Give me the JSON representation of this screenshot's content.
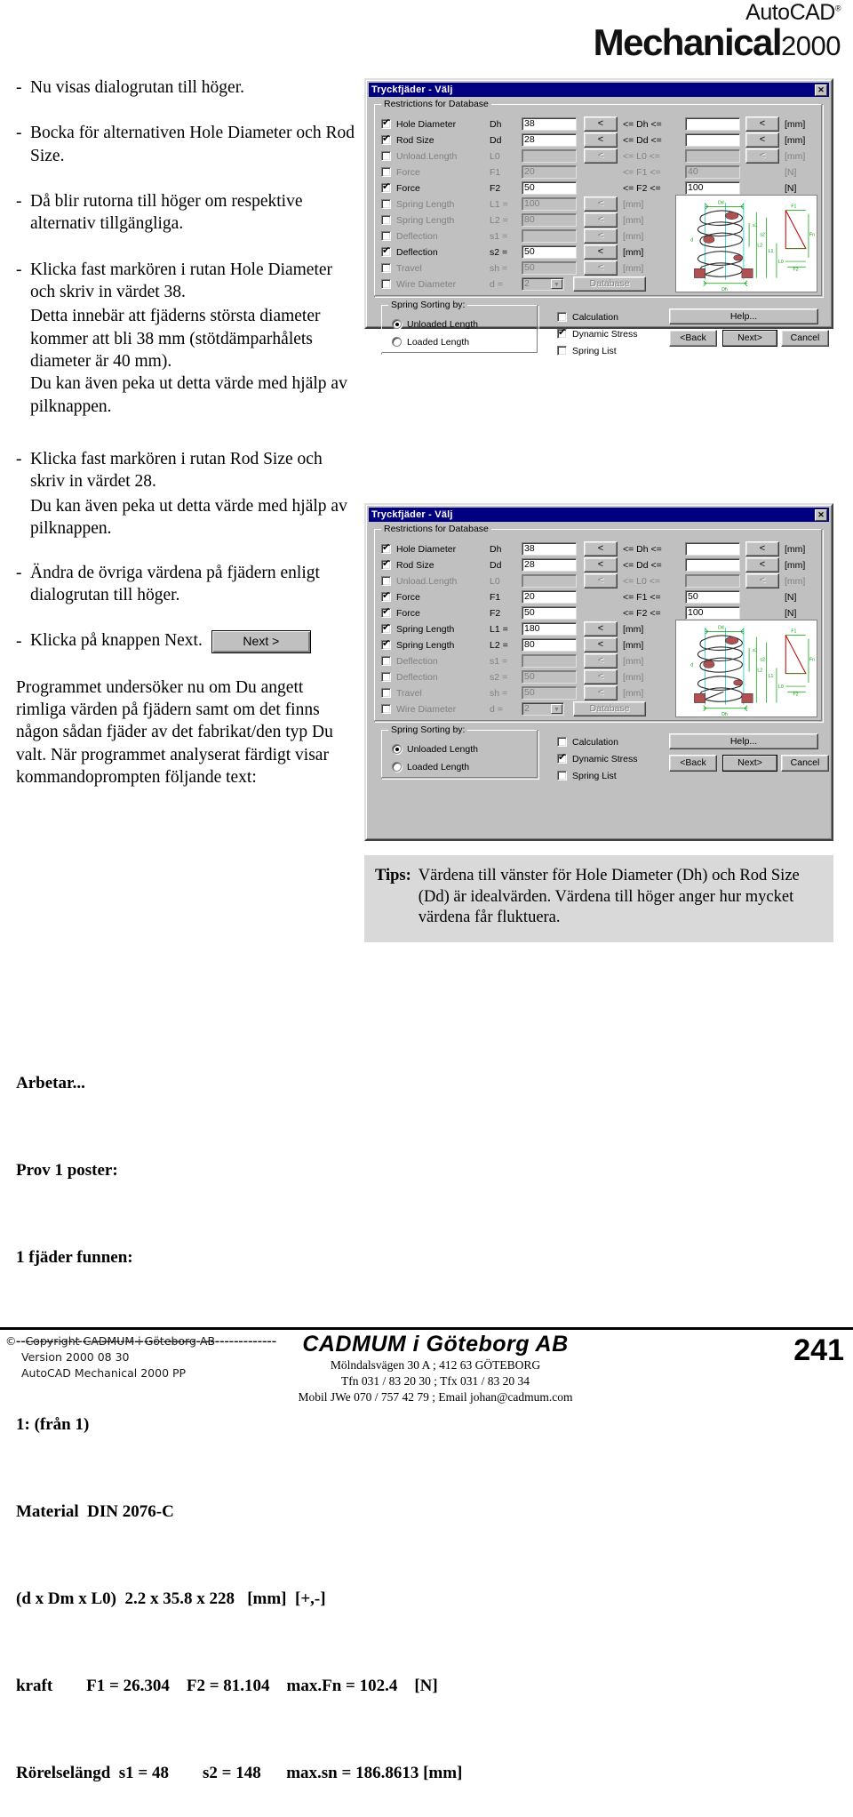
{
  "logo": {
    "auto": "AutoCAD",
    "reg": "®",
    "mechanical": "Mechanical",
    "year": "2000"
  },
  "left": {
    "b1": "Nu visas dialogrutan till höger.",
    "b2": "Bocka för alternativen Hole Diameter och Rod Size.",
    "b3": "Då blir rutorna till höger om respektive alternativ tillgängliga.",
    "b4": "Klicka fast markören i rutan Hole Diameter och skriv in värdet 38.",
    "b4p1": "Detta innebär att fjäderns största diameter kommer att bli 38 mm (stötdämparhålets diameter är 40 mm).",
    "b4p2": "Du kan även peka ut detta värde med hjälp av pilknappen.",
    "b5": "Klicka fast markören i rutan Rod Size och skriv in värdet 28.",
    "b5p1": "Du kan även peka ut detta värde med hjälp av pilknappen.",
    "b6": "Ändra de övriga värdena på fjädern enligt dialogrutan till höger.",
    "b7": "Klicka på knappen Next.",
    "next_button": "Next >",
    "para_final": "Programmet undersöker nu om Du angett rimliga värden på fjädern samt om det finns någon sådan fjäder av det fabrikat/den typ Du valt. När programmet analyserat färdigt visar kommandoprompten följande text:"
  },
  "tips": {
    "label": "Tips:",
    "text": "Värdena till vänster för Hole Diameter (Dh) och Rod Size (Dd) är idealvärden. Värdena till höger anger hur mycket värdena får fluktuera."
  },
  "dialog": {
    "title": "Tryckfjäder - Välj",
    "close": "✕",
    "group_restrictions": "Restrictions for Database",
    "group_sorting": "Spring Sorting by:",
    "arrow_glyph": "<",
    "unit_mm": "[mm]",
    "unit_n": "[N]",
    "database_button": "Database",
    "help_button": "Help...",
    "back_button": "<Back",
    "next_button": "Next>",
    "cancel_button": "Cancel",
    "radio_unloaded": "Unloaded Length",
    "radio_loaded": "Loaded Length",
    "chk_calculation": "Calculation",
    "chk_dynamic": "Dynamic Stress",
    "chk_springlist": "Spring List"
  },
  "dialog1": {
    "rows": [
      {
        "label": "Hole Diameter",
        "checked": true,
        "sym": "Dh",
        "val1": "38",
        "op": "<= Dh <=",
        "val2": "",
        "unit": "[mm]",
        "enabled": true,
        "has_arrow1": true,
        "has_arrow2": true
      },
      {
        "label": "Rod Size",
        "checked": true,
        "sym": "Dd",
        "val1": "28",
        "op": "<= Dd <=",
        "val2": "",
        "unit": "[mm]",
        "enabled": true,
        "has_arrow1": true,
        "has_arrow2": true
      },
      {
        "label": "Unload.Length",
        "checked": false,
        "sym": "L0",
        "val1": "",
        "op": "<= L0 <=",
        "val2": "",
        "unit": "[mm]",
        "enabled": false,
        "has_arrow1": true,
        "has_arrow2": true
      },
      {
        "label": "Force",
        "checked": false,
        "sym": "F1",
        "val1": "20",
        "op": "<= F1 <=",
        "val2": "40",
        "unit": "[N]",
        "enabled": false,
        "has_arrow1": false,
        "has_arrow2": false
      },
      {
        "label": "Force",
        "checked": true,
        "sym": "F2",
        "val1": "50",
        "op": "<= F2 <=",
        "val2": "100",
        "unit": "[N]",
        "enabled": true,
        "has_arrow1": false,
        "has_arrow2": false
      },
      {
        "label": "Spring Length",
        "checked": false,
        "sym": "L1 =",
        "val1": "100",
        "op": "",
        "val2": "",
        "unit": "[mm]",
        "enabled": false,
        "has_arrow1": true,
        "has_arrow2": false
      },
      {
        "label": "Spring Length",
        "checked": false,
        "sym": "L2 =",
        "val1": "80",
        "op": "",
        "val2": "",
        "unit": "[mm]",
        "enabled": false,
        "has_arrow1": true,
        "has_arrow2": false
      },
      {
        "label": "Deflection",
        "checked": false,
        "sym": "s1 =",
        "val1": "",
        "op": "",
        "val2": "",
        "unit": "[mm]",
        "enabled": false,
        "has_arrow1": true,
        "has_arrow2": false
      },
      {
        "label": "Deflection",
        "checked": true,
        "sym": "s2 =",
        "val1": "50",
        "op": "",
        "val2": "",
        "unit": "[mm]",
        "enabled": true,
        "has_arrow1": true,
        "has_arrow2": false
      },
      {
        "label": "Travel",
        "checked": false,
        "sym": "sh =",
        "val1": "50",
        "op": "",
        "val2": "",
        "unit": "[mm]",
        "enabled": false,
        "has_arrow1": true,
        "has_arrow2": false
      },
      {
        "label": "Wire Diameter",
        "checked": false,
        "sym": "d =",
        "val1": "2",
        "op": "",
        "val2": "",
        "unit": "",
        "enabled": false,
        "has_arrow1": false,
        "has_arrow2": false
      }
    ],
    "sorting_selected": "Unloaded Length",
    "checks": {
      "calculation": false,
      "dynamic_stress": true,
      "spring_list": false
    }
  },
  "dialog2": {
    "rows": [
      {
        "label": "Hole Diameter",
        "checked": true,
        "sym": "Dh",
        "val1": "38",
        "op": "<= Dh <=",
        "val2": "",
        "unit": "[mm]",
        "enabled": true,
        "has_arrow1": true,
        "has_arrow2": true
      },
      {
        "label": "Rod Size",
        "checked": true,
        "sym": "Dd",
        "val1": "28",
        "op": "<= Dd <=",
        "val2": "",
        "unit": "[mm]",
        "enabled": true,
        "has_arrow1": true,
        "has_arrow2": true
      },
      {
        "label": "Unload.Length",
        "checked": false,
        "sym": "L0",
        "val1": "",
        "op": "<= L0 <=",
        "val2": "",
        "unit": "[mm]",
        "enabled": false,
        "has_arrow1": true,
        "has_arrow2": true
      },
      {
        "label": "Force",
        "checked": true,
        "sym": "F1",
        "val1": "20",
        "op": "<= F1 <=",
        "val2": "50",
        "unit": "[N]",
        "enabled": true,
        "has_arrow1": false,
        "has_arrow2": false
      },
      {
        "label": "Force",
        "checked": true,
        "sym": "F2",
        "val1": "50",
        "op": "<= F2 <=",
        "val2": "100",
        "unit": "[N]",
        "enabled": true,
        "has_arrow1": false,
        "has_arrow2": false
      },
      {
        "label": "Spring Length",
        "checked": true,
        "sym": "L1 =",
        "val1": "180",
        "op": "",
        "val2": "",
        "unit": "[mm]",
        "enabled": true,
        "has_arrow1": true,
        "has_arrow2": false
      },
      {
        "label": "Spring Length",
        "checked": true,
        "sym": "L2 =",
        "val1": "80",
        "op": "",
        "val2": "",
        "unit": "[mm]",
        "enabled": true,
        "has_arrow1": true,
        "has_arrow2": false
      },
      {
        "label": "Deflection",
        "checked": false,
        "sym": "s1 =",
        "val1": "",
        "op": "",
        "val2": "",
        "unit": "[mm]",
        "enabled": false,
        "has_arrow1": true,
        "has_arrow2": false
      },
      {
        "label": "Deflection",
        "checked": false,
        "sym": "s2 =",
        "val1": "50",
        "op": "",
        "val2": "",
        "unit": "[mm]",
        "enabled": false,
        "has_arrow1": true,
        "has_arrow2": false
      },
      {
        "label": "Travel",
        "checked": false,
        "sym": "sh =",
        "val1": "50",
        "op": "",
        "val2": "",
        "unit": "[mm]",
        "enabled": false,
        "has_arrow1": true,
        "has_arrow2": false
      },
      {
        "label": "Wire Diameter",
        "checked": false,
        "sym": "d =",
        "val1": "2",
        "op": "",
        "val2": "",
        "unit": "",
        "enabled": false,
        "has_arrow1": false,
        "has_arrow2": false
      }
    ],
    "sorting_selected": "Unloaded Length",
    "checks": {
      "calculation": false,
      "dynamic_stress": true,
      "spring_list": false
    }
  },
  "command_output": {
    "l1": "Arbetar...",
    "l2": "Prov 1 poster:",
    "l3": "1 fjäder funnen:",
    "l4": "-------------------------------------------------------",
    "l5": "1: (från 1)",
    "l6": "Material  DIN 2076-C",
    "l7": "(d x Dm x L0)  2.2 x 35.8 x 228   [mm]  [+,-]",
    "l8": "kraft        F1 = 26.304    F2 = 81.104    max.Fn = 102.4    [N]",
    "l9": "Rörelselängd  s1 = 48        s2 = 148      max.sn = 186.8613 [mm]"
  },
  "footer": {
    "copyright_symbol": "©",
    "copyright": "Copyright CADMUM i Göteborg AB",
    "version": "Version 2000 08 30",
    "product": "AutoCAD Mechanical 2000 PP",
    "company": "CADMUM i Göteborg AB",
    "address": "Mölndalsvägen 30 A ; 412 63 GÖTEBORG",
    "phone": "Tfn 031 / 83 20 30 ; Tfx 031 / 83 20 34",
    "mobile": "Mobil JWe 070 / 757 42 79 ; Email johan@cadmum.com",
    "page": "241"
  }
}
